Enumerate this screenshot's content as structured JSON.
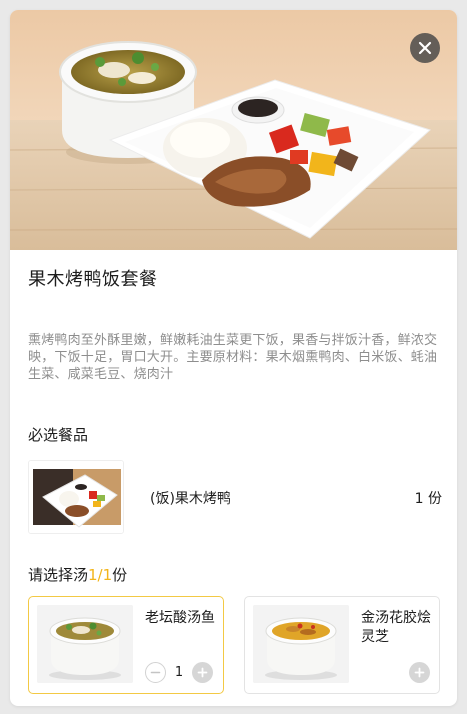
{
  "product": {
    "title": "果木烤鸭饭套餐",
    "description": "熏烤鸭肉至外酥里嫩，鲜嫩耗油生菜更下饭，果香与拌饭汁香，鲜浓交映，下饭十足，胃口大开。主要原材料：果木烟熏鸭肉、白米饭、蚝油生菜、咸菜毛豆、烧肉汁"
  },
  "required_section": {
    "title": "必选餐品",
    "item": {
      "name": "(饭)果木烤鸭",
      "quantity": "1 份"
    }
  },
  "soup_section": {
    "prefix": "请选择汤",
    "count": "1/1",
    "suffix": "份",
    "options": [
      {
        "name": "老坛酸汤鱼",
        "quantity": "1",
        "selected": true
      },
      {
        "name": "金汤花胶烩灵芝",
        "selected": false
      }
    ]
  },
  "colors": {
    "accent": "#f2b51b",
    "selected_border": "#f3c944",
    "description_text": "#8e8e8e"
  },
  "icons": {
    "close": "close-icon",
    "minus": "minus-icon",
    "plus": "plus-icon"
  }
}
